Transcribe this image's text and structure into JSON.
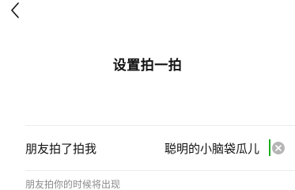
{
  "header": {
    "back_icon": "chevron-left-icon",
    "title": "设置拍一拍"
  },
  "form": {
    "label": "朋友拍了拍我",
    "value": "聪明的小脑袋瓜儿",
    "clear_icon": "clear-circle-icon"
  },
  "hint": "朋友拍你的时候将出现",
  "colors": {
    "caret": "#1aad19",
    "clear_icon": "#b5b5b5",
    "hint_text": "#8a8a8a"
  }
}
